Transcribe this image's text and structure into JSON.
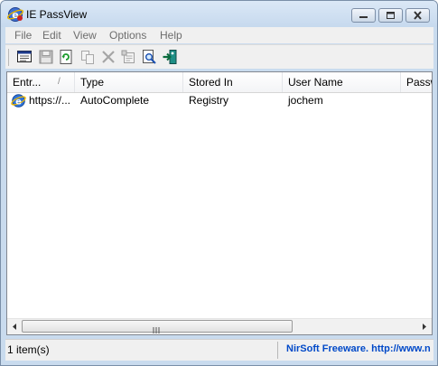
{
  "window": {
    "title": "IE PassView"
  },
  "menu": [
    "File",
    "Edit",
    "View",
    "Options",
    "Help"
  ],
  "toolbar": {
    "buttons": [
      "html-report-icon",
      "save-icon",
      "refresh-icon",
      "copy-icon",
      "delete-icon",
      "properties-icon",
      "find-icon",
      "exit-icon"
    ]
  },
  "list": {
    "columns": [
      "Entr...",
      "Type",
      "Stored In",
      "User Name",
      "Passw"
    ],
    "sort_indicator": "/",
    "rows": [
      {
        "entry": "https://...",
        "type": "AutoComplete",
        "stored_in": "Registry",
        "user_name": "jochem",
        "password": ""
      }
    ],
    "scroll_grip": "III"
  },
  "status": {
    "count": "1 item(s)",
    "link": "NirSoft Freeware.  http://www.nirsoft.net"
  },
  "colors": {
    "link": "#0049c8",
    "frame": "#c9dbee"
  }
}
